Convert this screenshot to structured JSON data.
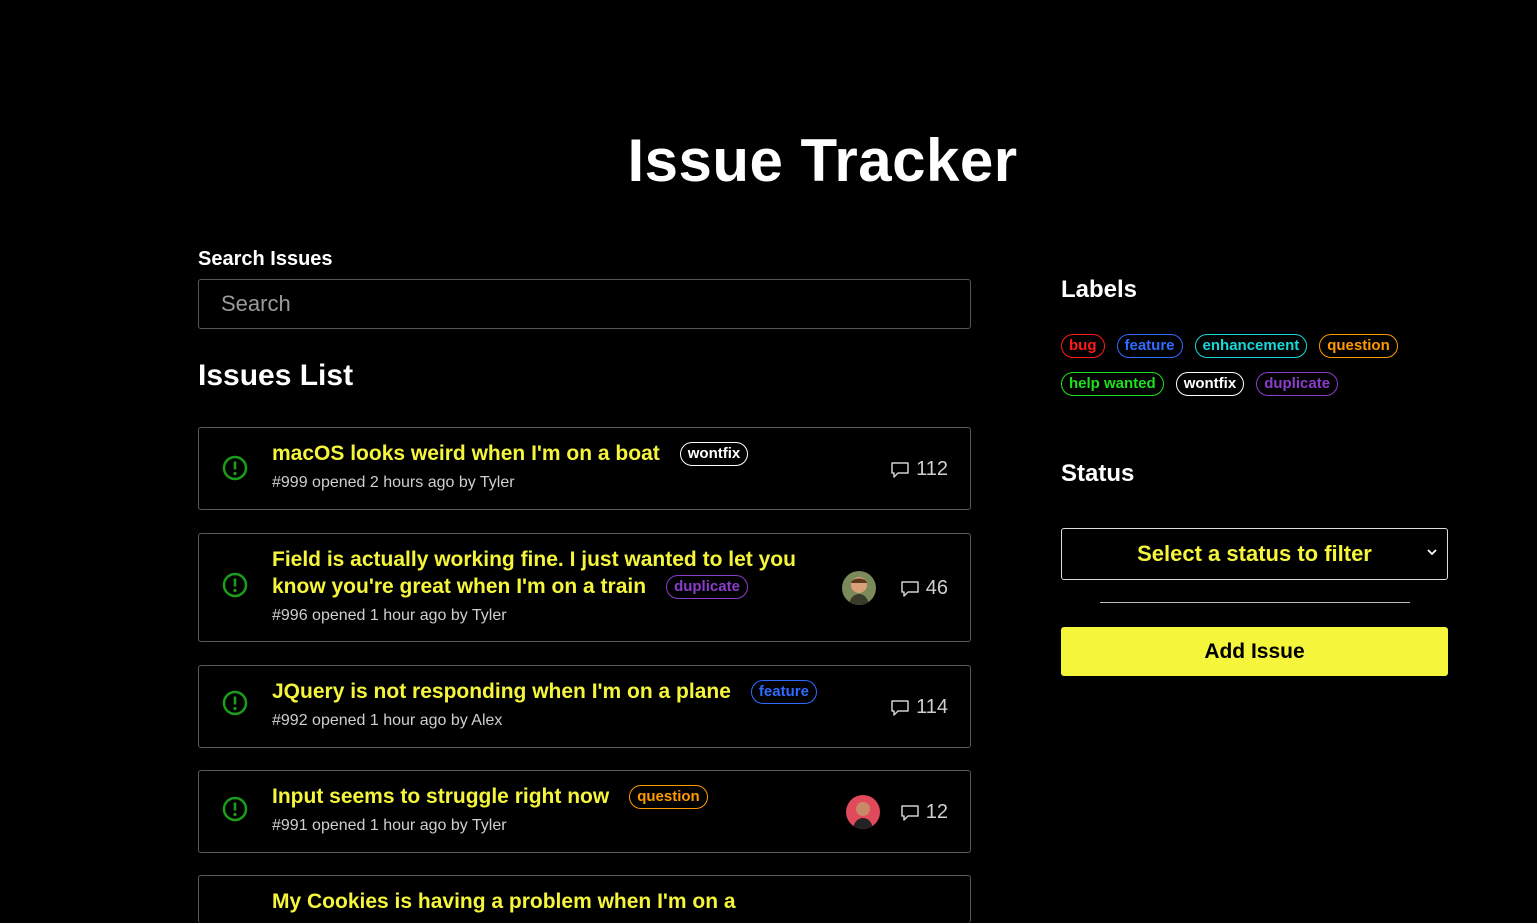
{
  "app": {
    "title": "Issue Tracker"
  },
  "search": {
    "label": "Search Issues",
    "placeholder": "Search"
  },
  "issues_heading": "Issues List",
  "issues": [
    {
      "title": "macOS looks weird when I'm on a boat",
      "label": "wontfix",
      "meta": "#999 opened 2 hours ago by Tyler",
      "comments": "112"
    },
    {
      "title": "Field is actually working fine. I just wanted to let you know you're great when I'm on a train",
      "label": "duplicate",
      "meta": "#996 opened 1 hour ago by Tyler",
      "comments": "46"
    },
    {
      "title": "JQuery is not responding when I'm on a plane",
      "label": "feature",
      "meta": "#992 opened 1 hour ago by Alex",
      "comments": "114"
    },
    {
      "title": "Input seems to struggle right now",
      "label": "question",
      "meta": "#991 opened 1 hour ago by Tyler",
      "comments": "12"
    },
    {
      "title": "My Cookies is having a problem when I'm on a",
      "label": "",
      "meta": "",
      "comments": ""
    }
  ],
  "sidebar": {
    "labels_heading": "Labels",
    "labels": [
      "bug",
      "feature",
      "enhancement",
      "question",
      "help wanted",
      "wontfix",
      "duplicate"
    ],
    "status_heading": "Status",
    "status_select": "Select a status to filter",
    "add_button": "Add Issue"
  },
  "colors": {
    "accent": "#f5f53b",
    "bug": "#ff1a1a",
    "feature": "#2f6bff",
    "enhancement": "#17d8d8",
    "question": "#ff9900",
    "help_wanted": "#1ee01e",
    "wontfix": "#ffffff",
    "duplicate": "#8a3dcc",
    "status_open": "#1a9e1a"
  }
}
